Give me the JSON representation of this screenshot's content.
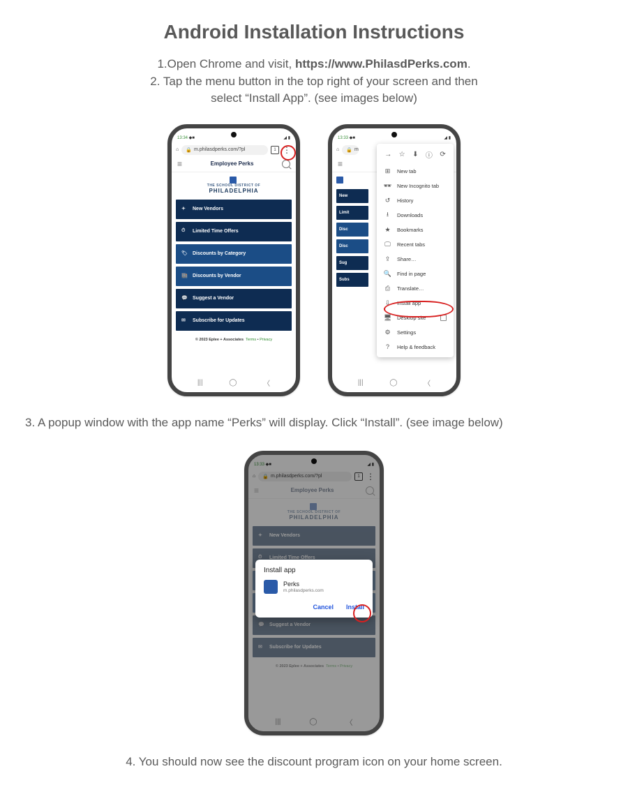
{
  "title": "Android Installation Instructions",
  "step1": {
    "num": "1.",
    "a": "Open Chrome and visit, ",
    "b": "https://www.PhilasdPerks.com",
    "c": "."
  },
  "step2": {
    "num": "2. ",
    "a": "Tap the menu button in the top right of your screen and then",
    "b": "select “Install App”.  (see images below)"
  },
  "step3": {
    "num": "3. ",
    "text": "A popup window with the app name “Perks” will display. Click “Install”. (see image below)"
  },
  "step4": {
    "num": "4. ",
    "text": "You should now see the discount program icon on your home screen."
  },
  "phone_common": {
    "time": "13:34",
    "signal": "▸▸▸",
    "wifi": "◥",
    "url": "m.philasdperks.com/?pl",
    "tabs": "1",
    "site_header": "Employee Perks",
    "brand_small": "THE SCHOOL DISTRICT OF",
    "brand_big": "PHILADELPHIA",
    "footer_a": "© 2023 Eplee + Associates",
    "footer_b": "Terms",
    "footer_c": "Privacy",
    "menu_items": [
      "New Vendors",
      "Limited Time Offers",
      "Discounts by Category",
      "Discounts by Vendor",
      "Suggest a Vendor",
      "Subscribe for Updates"
    ]
  },
  "chrome_menu": {
    "items": [
      "New tab",
      "New Incognito tab",
      "History",
      "Downloads",
      "Bookmarks",
      "Recent tabs",
      "Share…",
      "Find in page",
      "Translate…",
      "Install app",
      "Desktop site",
      "Settings",
      "Help & feedback"
    ]
  },
  "dialog": {
    "title": "Install app",
    "app_name": "Perks",
    "app_sub": "m.philasdperks.com",
    "cancel": "Cancel",
    "install": "Install"
  }
}
